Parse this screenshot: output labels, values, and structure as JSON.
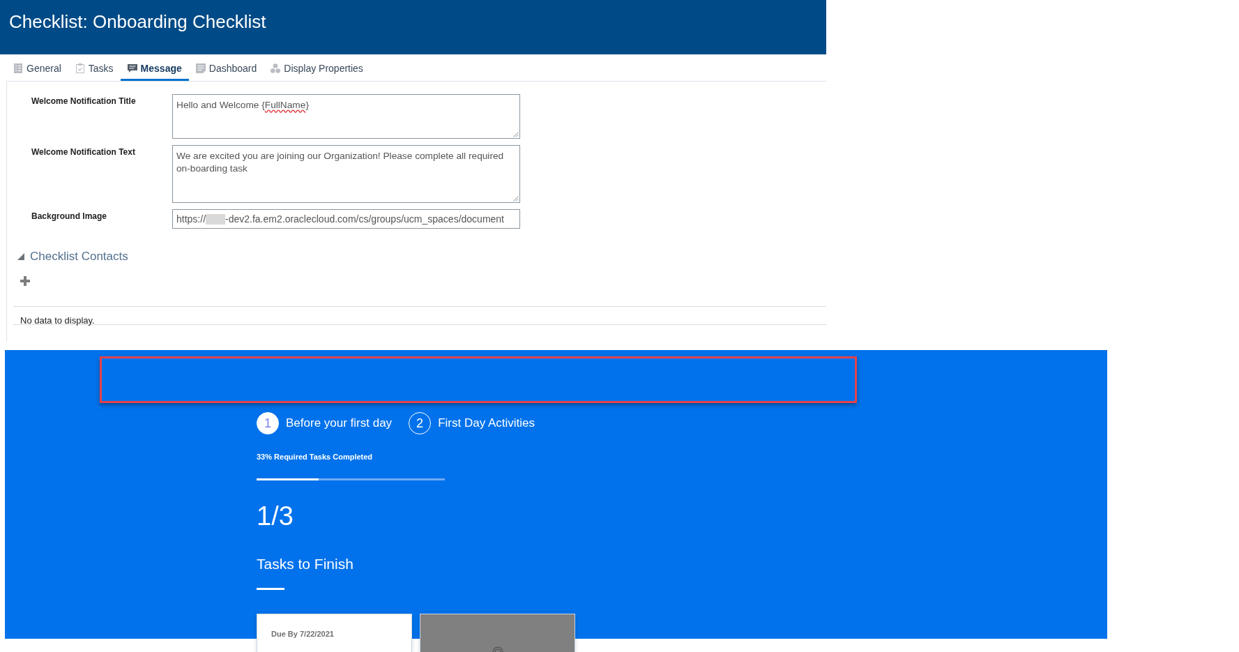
{
  "header": {
    "title": "Checklist: Onboarding Checklist"
  },
  "tabs": [
    {
      "label": "General",
      "selected": false
    },
    {
      "label": "Tasks",
      "selected": false
    },
    {
      "label": "Message",
      "selected": true
    },
    {
      "label": "Dashboard",
      "selected": false
    },
    {
      "label": "Display Properties",
      "selected": false
    }
  ],
  "form": {
    "fields": [
      {
        "label": "Welcome Notification Title",
        "kind": "textarea",
        "value": [
          {
            "kind": "text",
            "text": "Hello and Welcome {"
          },
          {
            "kind": "misspelled",
            "text": "FullName"
          },
          {
            "kind": "text",
            "text": "}"
          }
        ]
      },
      {
        "label": "Welcome Notification Text",
        "kind": "textarea",
        "value": [
          {
            "kind": "text",
            "text": "We are excited you are joining our Organization! Please complete all required on-boarding task"
          }
        ]
      },
      {
        "label": "Background Image",
        "kind": "input",
        "value": [
          {
            "kind": "text",
            "text": "https://"
          },
          {
            "kind": "redacted"
          },
          {
            "kind": "text",
            "text": "-dev2.fa.em2.oraclecloud.com/cs/groups/ucm_spaces/document"
          }
        ]
      }
    ]
  },
  "contacts": {
    "title": "Checklist Contacts",
    "expanded": true,
    "table": {
      "empty_message": "No data to display."
    }
  },
  "preview": {
    "highlighted": true,
    "steps": [
      {
        "number": "1",
        "label": "Before your first day",
        "selected": true
      },
      {
        "number": "2",
        "label": "First Day Activities",
        "selected": false
      }
    ],
    "progress": {
      "label": "33% Required Tasks Completed",
      "level": 0.33
    },
    "count": "1/3",
    "heading": "Tasks to Finish",
    "cards": [
      {
        "kind": "task",
        "due": "Due By 7/22/2021"
      },
      {
        "kind": "image"
      }
    ]
  }
}
